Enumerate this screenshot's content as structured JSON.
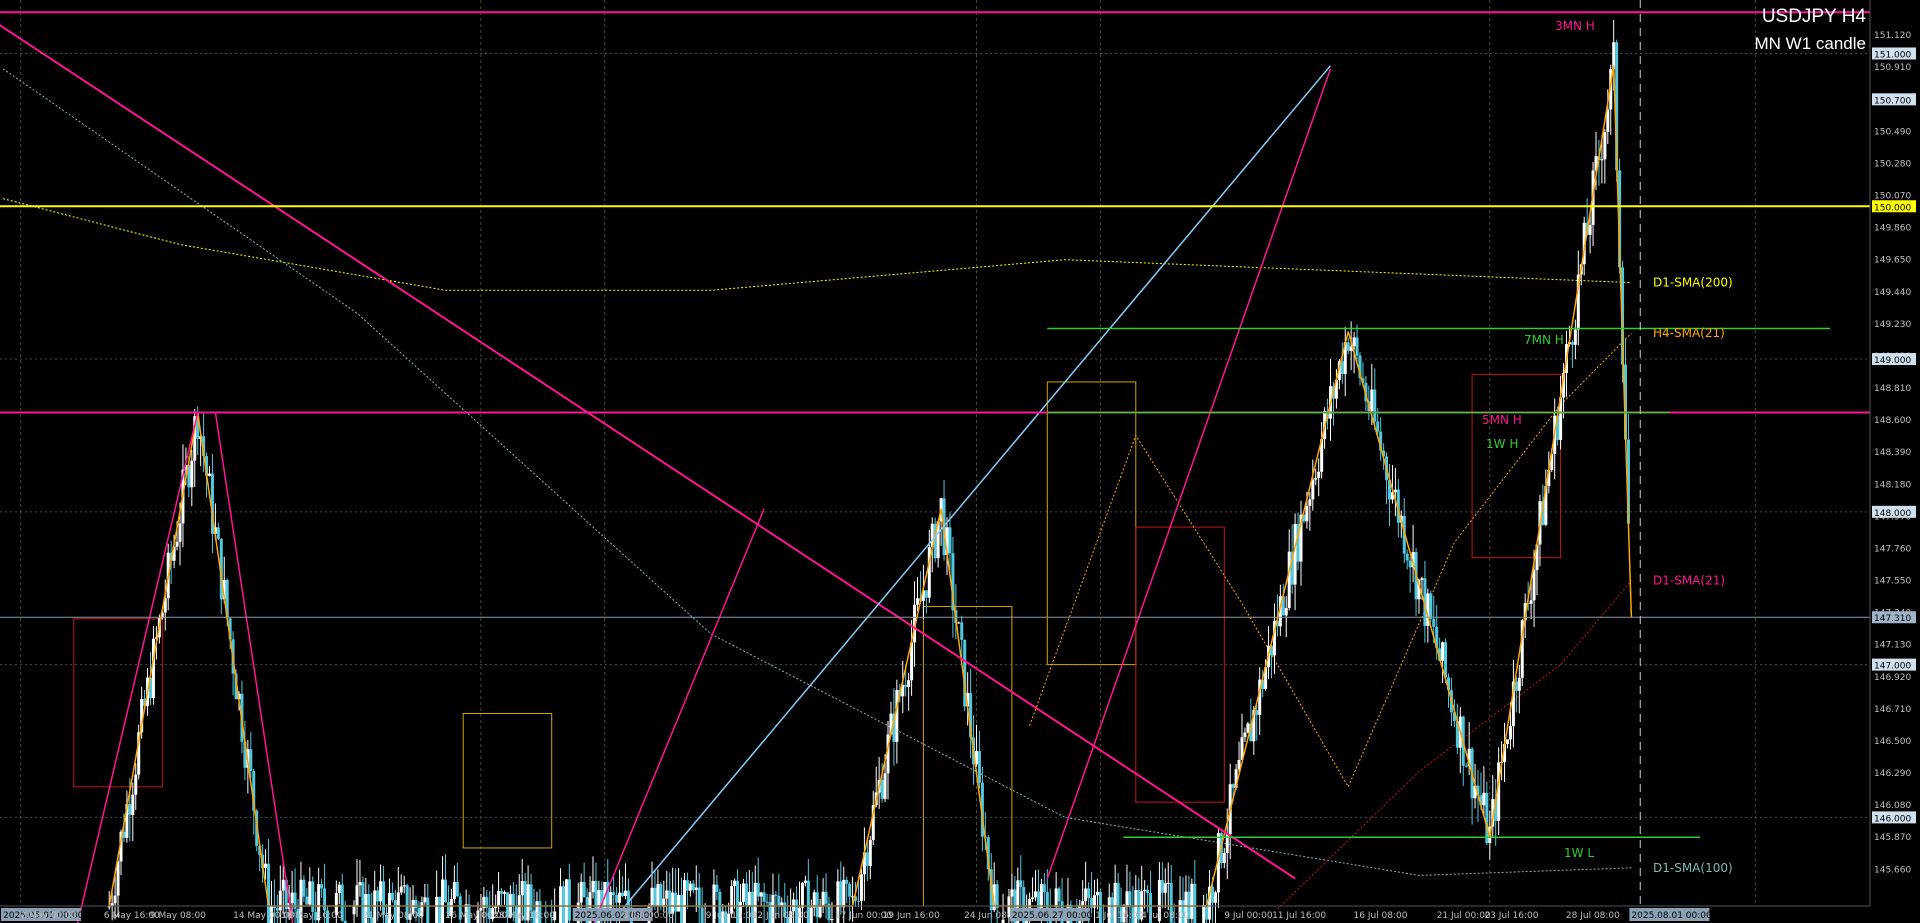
{
  "header": {
    "title": "USDJPY H4",
    "subtitle": "MN W1 candle"
  },
  "colors": {
    "background": "#000000",
    "grid": "#2e3a3a",
    "axis_text": "#bfbfbf",
    "up_candle": "#ffffff",
    "down_candle": "#4fc8e0",
    "magenta": "#ff1493",
    "yellow": "#ffff00",
    "orange": "#ffa500",
    "lightblue": "#87cefa",
    "green": "#32cd32",
    "red": "#c01818",
    "gold": "#d4a600"
  },
  "chart_data": {
    "type": "candlestick",
    "title": "USDJPY H4",
    "ylim": [
      145.42,
      151.35
    ],
    "y_ticks": [
      "151.120",
      "150.910",
      "150.700",
      "150.490",
      "150.280",
      "150.070",
      "149.860",
      "149.650",
      "149.440",
      "149.230",
      "149.020",
      "148.810",
      "148.600",
      "148.390",
      "148.180",
      "147.970",
      "147.760",
      "147.550",
      "147.340",
      "147.130",
      "146.920",
      "146.710",
      "146.500",
      "146.290",
      "146.080",
      "145.870",
      "145.660"
    ],
    "x_ticks": [
      "2025.05.01 00:00",
      "2 May 00:00",
      "6 May 16:00",
      "9 May 08:00",
      "14 May 00:00",
      "16 May 16:00",
      "21 May 08:00",
      "26 May 00:00",
      "28 May 16:00",
      "2025.06.02 08:00",
      "5 Jun 00:00",
      "9 Jun 16:00",
      "12 Jun 08:00",
      "17 Jun 00:00",
      "19 Jun 16:00",
      "24 Jun 08:00",
      "2025.06.27 00:00",
      "1 Jul 16:00",
      "4 Jul 08:00",
      "9 Jul 00:00",
      "11 Jul 16:00",
      "16 Jul 08:00",
      "21 Jul 00:00",
      "23 Jul 16:00",
      "28 Jul 08:00",
      "2025.08.01 00:00"
    ],
    "price_tags": [
      {
        "price": 151.0,
        "label": "151.000"
      },
      {
        "price": 150.7,
        "label": "150.700"
      },
      {
        "price": 150.0,
        "label": "150.000"
      },
      {
        "price": 149.0,
        "label": "149.000"
      },
      {
        "price": 148.0,
        "label": "148.000"
      },
      {
        "price": 147.31,
        "label": "147.310"
      },
      {
        "price": 147.0,
        "label": "147.000"
      },
      {
        "price": 146.0,
        "label": "146.000"
      }
    ],
    "horizontal_lines": [
      {
        "price": 151.27,
        "label": ""
      },
      {
        "price": 150.0,
        "label": ""
      },
      {
        "price": 148.65,
        "label": ""
      },
      {
        "price": 149.2,
        "label": "7MN H"
      },
      {
        "price": 148.65,
        "label": "1W H"
      },
      {
        "price": 145.87,
        "label": "1W L"
      }
    ],
    "annotations": [
      "3MN H",
      "5MN H",
      "7MN H",
      "1W H",
      "1W L"
    ],
    "indicators": [
      {
        "name": "D1-SMA(200)",
        "price": 149.5
      },
      {
        "name": "H4-SMA(21)",
        "price": 149.17
      },
      {
        "name": "D1-SMA(21)",
        "price": 147.55
      },
      {
        "name": "D1-SMA(100)",
        "price": 145.67
      }
    ],
    "zigzag_points": [
      [
        "2025-05-07",
        145.42
      ],
      [
        "2025-05-12",
        148.65
      ],
      [
        "2025-05-16",
        145.42
      ],
      [
        "2025-06-18",
        145.42
      ],
      [
        "2025-06-23",
        148.02
      ],
      [
        "2025-06-26",
        145.42
      ],
      [
        "2025-07-08",
        145.42
      ],
      [
        "2025-07-16",
        149.18
      ],
      [
        "2025-07-24",
        145.87
      ],
      [
        "2025-07-31",
        150.92
      ],
      [
        "2025-08-01",
        147.31
      ]
    ],
    "last_price": 147.31
  }
}
